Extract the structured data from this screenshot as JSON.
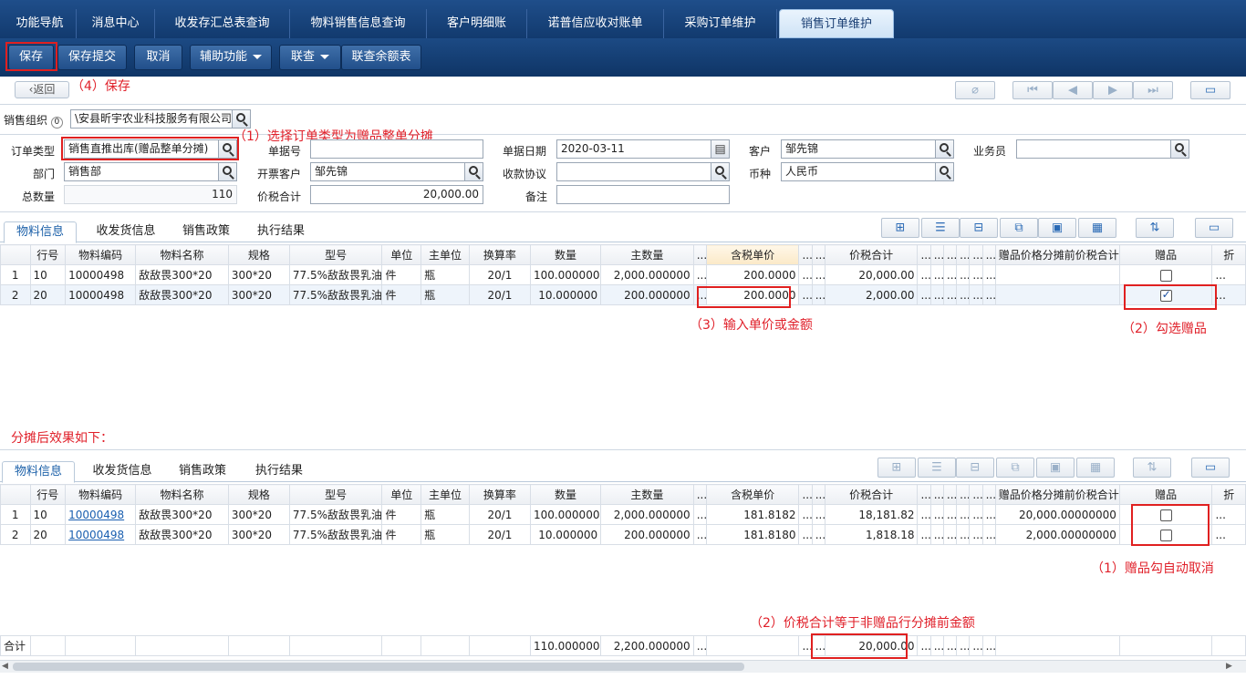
{
  "nav_tabs": [
    "功能导航",
    "消息中心",
    "收发存汇总表查询",
    "物料销售信息查询",
    "客户明细账",
    "诺普信应收对账单",
    "采购订单维护",
    "销售订单维护"
  ],
  "toolbar": {
    "save": "保存",
    "save_submit": "保存提交",
    "cancel": "取消",
    "assist": "辅助功能",
    "query": "联查",
    "balance": "联查余额表"
  },
  "back_label": "返回",
  "annotations": {
    "save": "（4）保存",
    "order_type": "（1）选择订单类型为赠品整单分摊",
    "input_price": "（3）输入单价或金额",
    "check_gift": "（2）勾选赠品",
    "after_effect": "分摊后效果如下：",
    "auto_uncheck": "（1）赠品勾自动取消",
    "total_equal": "（2）价税合计等于非赠品行分摊前金额"
  },
  "form": {
    "sales_org_label": "销售组织",
    "sales_org_badge": "0",
    "sales_org_value": "\\安县昕宇农业科技服务有限公司",
    "order_type_label": "订单类型",
    "order_type_value": "销售直推出库(赠品整单分摊)",
    "doc_no_label": "单据号",
    "doc_no_value": "",
    "date_label": "单据日期",
    "date_value": "2020-03-11",
    "customer_label": "客户",
    "customer_value": "邹先锦",
    "salesman_label": "业务员",
    "salesman_value": "",
    "dept_label": "部门",
    "dept_value": "销售部",
    "invoice_cust_label": "开票客户",
    "invoice_cust_value": "邹先锦",
    "payment_label": "收款协议",
    "payment_value": "",
    "currency_label": "币种",
    "currency_value": "人民币",
    "total_qty_label": "总数量",
    "total_qty_value": "110",
    "total_tax_label": "价税合计",
    "total_tax_value": "20,000.00",
    "remark_label": "备注",
    "remark_value": ""
  },
  "sub_tabs": [
    "物料信息",
    "收发货信息",
    "销售政策",
    "执行结果"
  ],
  "columns": [
    "",
    "行号",
    "物料编码",
    "物料名称",
    "规格",
    "型号",
    "单位",
    "主单位",
    "换算率",
    "数量",
    "主数量",
    "...",
    "含税单价",
    "...",
    "...",
    "价税合计",
    "...",
    "...",
    "...",
    "...",
    "...",
    "...",
    "赠品价格分摊前价税合计",
    "赠品",
    "折"
  ],
  "grid1": [
    {
      "idx": "1",
      "line": "10",
      "code": "10000498",
      "name": "敌敌畏300*20",
      "spec": "300*20",
      "model": "77.5%敌敌畏乳油",
      "unit": "件",
      "main_unit": "瓶",
      "rate": "20/1",
      "qty": "100.000000",
      "main_qty": "2,000.000000",
      "price": "200.0000",
      "amount": "20,000.00",
      "pre_amount": "",
      "gift": false
    },
    {
      "idx": "2",
      "line": "20",
      "code": "10000498",
      "name": "敌敌畏300*20",
      "spec": "300*20",
      "model": "77.5%敌敌畏乳油",
      "unit": "件",
      "main_unit": "瓶",
      "rate": "20/1",
      "qty": "10.000000",
      "main_qty": "200.000000",
      "price": "200.0000",
      "amount": "2,000.00",
      "pre_amount": "",
      "gift": true
    }
  ],
  "grid2": [
    {
      "idx": "1",
      "line": "10",
      "code": "10000498",
      "name": "敌敌畏300*20",
      "spec": "300*20",
      "model": "77.5%敌敌畏乳油",
      "unit": "件",
      "main_unit": "瓶",
      "rate": "20/1",
      "qty": "100.000000",
      "main_qty": "2,000.000000",
      "price": "181.8182",
      "amount": "18,181.82",
      "pre_amount": "20,000.00000000",
      "gift": false
    },
    {
      "idx": "2",
      "line": "20",
      "code": "10000498",
      "name": "敌敌畏300*20",
      "spec": "300*20",
      "model": "77.5%敌敌畏乳油",
      "unit": "件",
      "main_unit": "瓶",
      "rate": "20/1",
      "qty": "10.000000",
      "main_qty": "200.000000",
      "price": "181.8180",
      "amount": "1,818.18",
      "pre_amount": "2,000.00000000",
      "gift": false
    }
  ],
  "totals": {
    "label": "合计",
    "qty": "110.000000",
    "main_qty": "2,200.000000",
    "amount": "20,000.00"
  }
}
